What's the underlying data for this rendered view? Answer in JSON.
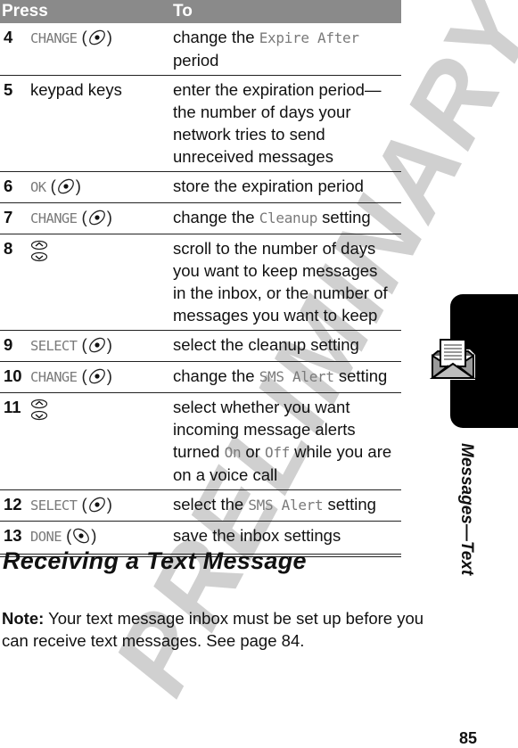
{
  "watermark": "PRELIMINARY",
  "table": {
    "headers": {
      "press": "Press",
      "to": "To"
    },
    "rows": [
      {
        "step": "4",
        "key_label": "CHANGE",
        "key_icon": "left-softkey-icon",
        "desc_parts": [
          {
            "t": "change the "
          },
          {
            "d": "Expire After"
          },
          {
            "t": " period"
          }
        ]
      },
      {
        "step": "5",
        "key_text": "keypad keys",
        "desc_parts": [
          {
            "t": "enter the expiration period—the number of days your network tries to send unreceived messages"
          }
        ]
      },
      {
        "step": "6",
        "key_label": "OK",
        "key_icon": "left-softkey-icon",
        "desc_parts": [
          {
            "t": "store the expiration period"
          }
        ]
      },
      {
        "step": "7",
        "key_label": "CHANGE",
        "key_icon": "left-softkey-icon",
        "desc_parts": [
          {
            "t": "change the "
          },
          {
            "d": "Cleanup"
          },
          {
            "t": " setting"
          }
        ]
      },
      {
        "step": "8",
        "key_icon": "nav-up-down-icon",
        "desc_parts": [
          {
            "t": "scroll to the number of days you want to keep messages in the inbox, or the number of messages you want to keep"
          }
        ]
      },
      {
        "step": "9",
        "key_label": "SELECT",
        "key_icon": "left-softkey-icon",
        "desc_parts": [
          {
            "t": "select the cleanup setting"
          }
        ]
      },
      {
        "step": "10",
        "key_label": "CHANGE",
        "key_icon": "left-softkey-icon",
        "desc_parts": [
          {
            "t": "change the "
          },
          {
            "d": "SMS Alert"
          },
          {
            "t": " setting"
          }
        ]
      },
      {
        "step": "11",
        "key_icon": "nav-up-down-icon",
        "desc_parts": [
          {
            "t": "select whether you want incoming message alerts turned "
          },
          {
            "d": "On"
          },
          {
            "t": " or "
          },
          {
            "d": "Off"
          },
          {
            "t": " while you are on a voice call"
          }
        ]
      },
      {
        "step": "12",
        "key_label": "SELECT",
        "key_icon": "left-softkey-icon",
        "desc_parts": [
          {
            "t": "select the "
          },
          {
            "d": "SMS Alert"
          },
          {
            "t": " setting"
          }
        ]
      },
      {
        "step": "13",
        "key_label": "DONE",
        "key_icon": "right-softkey-icon",
        "desc_parts": [
          {
            "t": "save the inbox settings"
          }
        ]
      }
    ]
  },
  "section": {
    "title": "Receiving a Text Message",
    "note_label": "Note:",
    "note_text": " Your text message inbox must be set up before you can receive text messages. See page 84."
  },
  "side_tab": {
    "label": "Messages—Text",
    "icon": "envelope-message-icon"
  },
  "page_number": "85",
  "colors": {
    "header_bg": "#8a8a8a",
    "display_text": "#7a7a7a",
    "watermark": "#d0d0d0",
    "tab": "#000000"
  }
}
